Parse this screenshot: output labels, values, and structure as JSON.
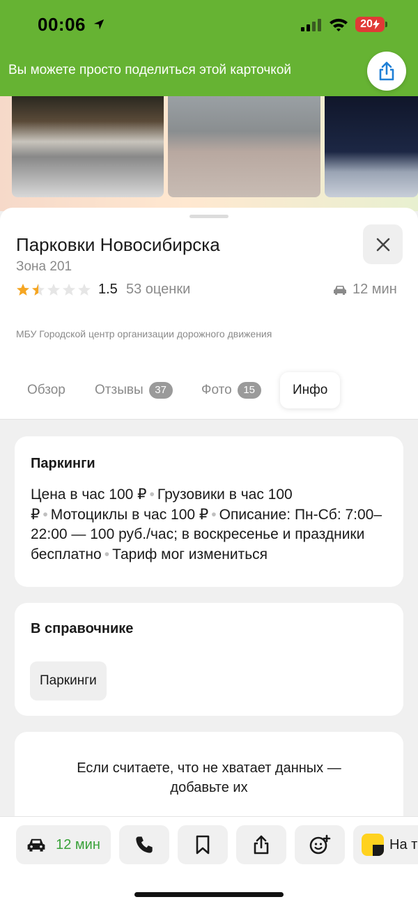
{
  "status_bar": {
    "time": "00:06",
    "battery": "20"
  },
  "banner": {
    "text": "Вы можете просто поделиться этой карточкой",
    "share_icon": "share-icon"
  },
  "place": {
    "title": "Парковки Новосибирска",
    "subtitle": "Зона 201",
    "rating": 1.5,
    "rating_text": "1.5",
    "rating_count": "53 оценки",
    "eta": "12 мин",
    "organization": "МБУ Городской центр организации дорожного движения"
  },
  "tabs": [
    {
      "label": "Обзор"
    },
    {
      "label": "Отзывы",
      "count": "37"
    },
    {
      "label": "Фото",
      "count": "15"
    },
    {
      "label": "Инфо"
    }
  ],
  "parking_card": {
    "title": "Паркинги",
    "items": [
      "Цена в час 100 ₽",
      "Грузовики в час 100 ₽",
      "Мотоциклы в час 100 ₽",
      "Описание: Пн-Сб: 7:00–22:00 — 100 руб./час; в воскресенье и праздники бесплатно",
      "Тариф мог измениться"
    ]
  },
  "directory_card": {
    "title": "В справочнике",
    "chip": "Паркинги"
  },
  "add_data_card": {
    "line1": "Если считаете, что не хватает данных —",
    "line2": "добавьте их"
  },
  "bottom_bar": {
    "route_label": "12 мин",
    "yandex_label": "На т"
  },
  "colors": {
    "brand_green": "#66b333",
    "route_green": "#3aa23a",
    "star_gold": "#f5a623",
    "battery_red": "#e03a36"
  }
}
